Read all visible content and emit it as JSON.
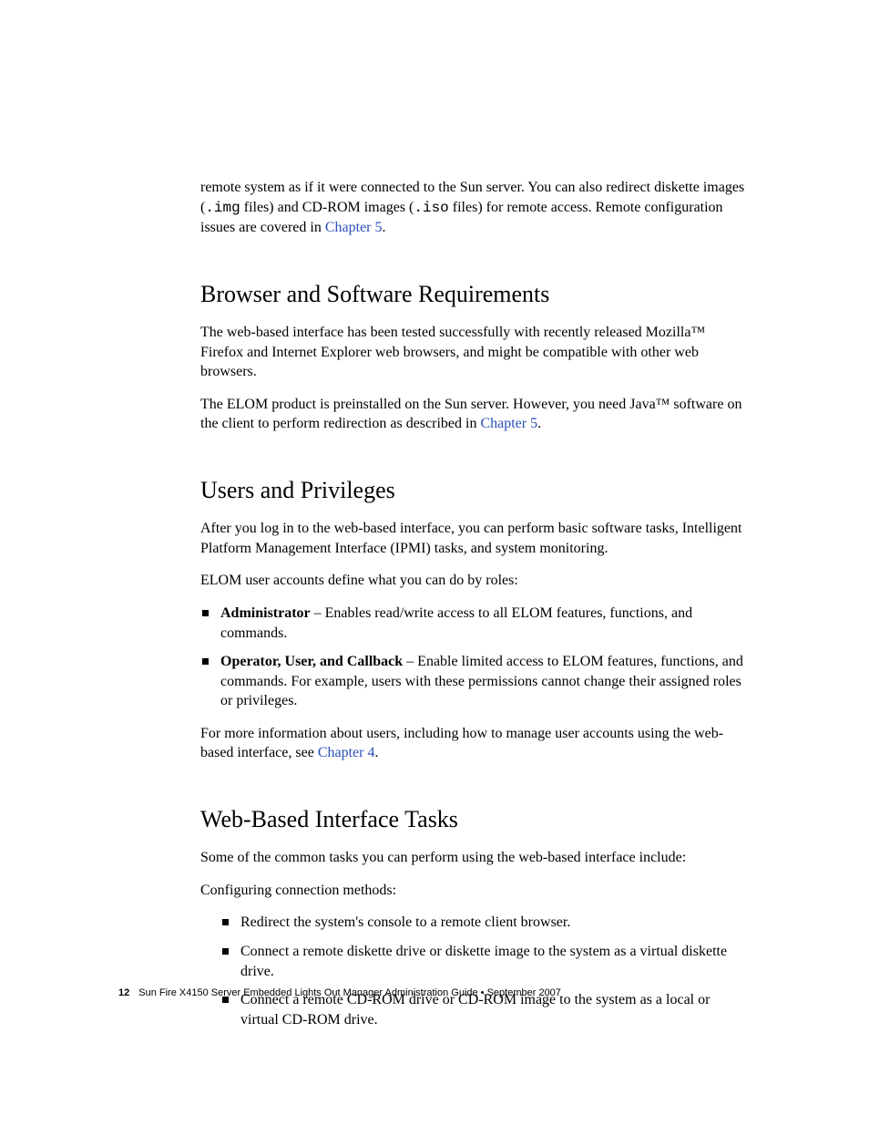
{
  "intro": {
    "part1": "remote system as if it were connected to the Sun server. You can also redirect diskette images (",
    "code1": ".img",
    "part2": " files) and CD-ROM images (",
    "code2": ".iso",
    "part3": " files) for remote access. Remote configuration issues are covered in ",
    "link": "Chapter 5",
    "part4": "."
  },
  "s1": {
    "heading": "Browser and Software Requirements",
    "p1": "The web-based interface has been tested successfully with recently released Mozilla™ Firefox and Internet Explorer web browsers, and might be compatible with other web browsers.",
    "p2a": "The ELOM product is preinstalled on the Sun server. However, you need Java™ software on the client to perform redirection as described in ",
    "p2link": "Chapter 5",
    "p2b": "."
  },
  "s2": {
    "heading": "Users and Privileges",
    "p1": "After you log in to the web-based interface, you can perform basic software tasks, Intelligent Platform Management Interface (IPMI) tasks, and system monitoring.",
    "p2": "ELOM user accounts define what you can do by roles:",
    "roles": [
      {
        "label": "Administrator",
        "text": " – Enables read/write access to all ELOM features, functions, and commands."
      },
      {
        "label": "Operator, User, and Callback",
        "text": " – Enable limited access to ELOM features, functions, and commands. For example, users with these permissions cannot change their assigned roles or privileges."
      }
    ],
    "p3a": "For more information about users, including how to manage user accounts using the web-based interface, see ",
    "p3link": "Chapter 4",
    "p3b": "."
  },
  "s3": {
    "heading": "Web-Based Interface Tasks",
    "p1": "Some of the common tasks you can perform using the web-based interface include:",
    "p2": "Configuring connection methods:",
    "items": [
      "Redirect the system's console to a remote client browser.",
      "Connect a remote diskette drive or diskette image to the system as a virtual diskette drive.",
      "Connect a remote CD-ROM drive or CD-ROM image to the system as a local or virtual CD-ROM drive."
    ]
  },
  "footer": {
    "page": "12",
    "text": "Sun Fire X4150 Server Embedded Lights Out Manager Administration Guide • September 2007"
  }
}
